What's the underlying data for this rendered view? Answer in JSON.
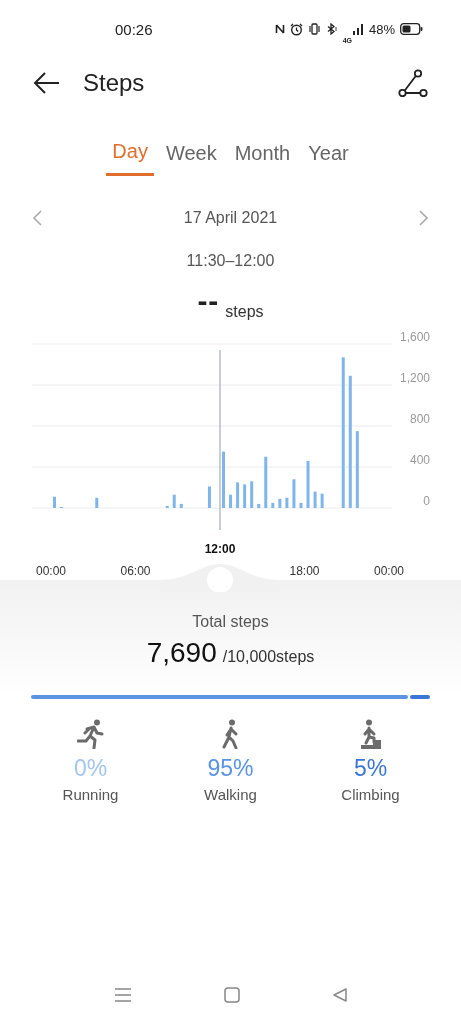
{
  "status_bar": {
    "time": "00:26",
    "network": "4G",
    "battery": "48%"
  },
  "header": {
    "title": "Steps"
  },
  "tabs": [
    {
      "label": "Day",
      "selected": true
    },
    {
      "label": "Week",
      "selected": false
    },
    {
      "label": "Month",
      "selected": false
    },
    {
      "label": "Year",
      "selected": false
    }
  ],
  "date": "17 April 2021",
  "time_range": "11:30–12:00",
  "reading": {
    "value": "--",
    "unit": "steps"
  },
  "chart": {
    "chart_data": {
      "type": "bar",
      "x": [
        0,
        0.5,
        1,
        1.5,
        2,
        2.5,
        3,
        3.5,
        4,
        4.5,
        5,
        5.5,
        6,
        6.5,
        7,
        7.5,
        8,
        8.5,
        9,
        9.5,
        10,
        10.5,
        11,
        11.5,
        12,
        12.5,
        13,
        13.5,
        14,
        14.5,
        15,
        15.5,
        16,
        16.5,
        17,
        17.5,
        18,
        18.5,
        19,
        19.5,
        20,
        20.5,
        21,
        21.5,
        22,
        22.5,
        23,
        23.5
      ],
      "series": [
        {
          "color": "#7fb5ea",
          "values": [
            110,
            10,
            0,
            0,
            0,
            0,
            100,
            0,
            0,
            0,
            0,
            0,
            0,
            0,
            0,
            0,
            20,
            130,
            40,
            0,
            0,
            0,
            210,
            0,
            550,
            130,
            250,
            230,
            260,
            40,
            500,
            50,
            90,
            100,
            280,
            50,
            460,
            160,
            140,
            0,
            0,
            1470,
            1290,
            750,
            0,
            0,
            0,
            0
          ]
        }
      ],
      "xlim": [
        0,
        24
      ],
      "xticks": [
        {
          "value": 0,
          "label": "00:00"
        },
        {
          "value": 6,
          "label": "06:00"
        },
        {
          "value": 18,
          "label": "18:00"
        },
        {
          "value": 24,
          "label": "00:00"
        }
      ],
      "ylim": [
        0,
        1600
      ],
      "grid": true,
      "ref_lines": [
        {
          "axis": "x",
          "value": 12,
          "label": "12:00"
        }
      ],
      "yticks": [
        {
          "value": 0,
          "label": "0"
        },
        {
          "value": 400,
          "label": "400"
        },
        {
          "value": 800,
          "label": "800"
        },
        {
          "value": 1200,
          "label": "1,200"
        },
        {
          "value": 1600,
          "label": "1,600"
        }
      ]
    }
  },
  "summary": {
    "label": "Total steps",
    "total": "7,690",
    "goal": "/10,000steps"
  },
  "activities": [
    {
      "kind": "running",
      "percent": "0%",
      "label": "Running",
      "color": "#a3c4ef"
    },
    {
      "kind": "walking",
      "percent": "95%",
      "label": "Walking",
      "color": "#5b93e3"
    },
    {
      "kind": "climbing",
      "percent": "5%",
      "label": "Climbing",
      "color": "#3b76d6"
    }
  ]
}
